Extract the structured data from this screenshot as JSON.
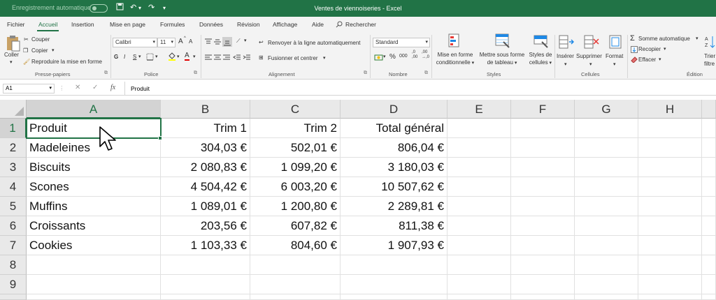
{
  "title_bar": {
    "autosave_label": "Enregistrement automatique",
    "autosave_state": "off",
    "window_title": "Ventes de viennoiseries - Excel"
  },
  "menu": {
    "tabs": [
      "Fichier",
      "Accueil",
      "Insertion",
      "Mise en page",
      "Formules",
      "Données",
      "Révision",
      "Affichage",
      "Aide"
    ],
    "active_tab": "Accueil",
    "search_label": "Rechercher"
  },
  "ribbon": {
    "clipboard": {
      "paste": "Coller",
      "cut": "Couper",
      "copy": "Copier",
      "format_painter": "Reproduire la mise en forme",
      "group": "Presse-papiers"
    },
    "font": {
      "font_name": "Calibri",
      "font_size": "11",
      "bold": "G",
      "italic": "I",
      "underline": "S",
      "grow": "A",
      "shrink": "A",
      "color_a": "A",
      "group": "Police"
    },
    "alignment": {
      "wrap_text": "Renvoyer à la ligne automatiquement",
      "merge_center": "Fusionner et centrer",
      "group": "Alignement"
    },
    "number": {
      "format": "Standard",
      "percent": "%",
      "thousands": "000",
      "inc_decimal": ",0\n,00",
      "group": "Nombre"
    },
    "styles": {
      "conditional": [
        "Mise en forme",
        "conditionnelle"
      ],
      "as_table": [
        "Mettre sous forme",
        "de tableau"
      ],
      "cell_styles": [
        "Styles de",
        "cellules"
      ],
      "group": "Styles"
    },
    "cells": {
      "insert": "Insérer",
      "delete": "Supprimer",
      "format": "Format",
      "group": "Cellules"
    },
    "editing": {
      "autosum": "Somme automatique",
      "fill": "Recopier",
      "clear": "Effacer",
      "sort": [
        "Trier",
        "filtre"
      ],
      "group": "Édition"
    }
  },
  "formula_bar": {
    "name_box": "A1",
    "fx": "fx",
    "content": "Produit"
  },
  "sheet": {
    "columns": [
      "A",
      "B",
      "C",
      "D",
      "E",
      "F",
      "G",
      "H"
    ],
    "rows": [
      "1",
      "2",
      "3",
      "4",
      "5",
      "6",
      "7",
      "8",
      "9"
    ],
    "headers": [
      "Produit",
      "Trim 1",
      "Trim 2",
      "Total général"
    ],
    "data": [
      [
        "Madeleines",
        "304,03 €",
        "502,01 €",
        "806,04 €"
      ],
      [
        "Biscuits",
        "2 080,83 €",
        "1 099,20 €",
        "3 180,03 €"
      ],
      [
        "Scones",
        "4 504,42 €",
        "6 003,20 €",
        "10 507,62 €"
      ],
      [
        "Muffins",
        "1 089,01 €",
        "1 200,80 €",
        "2 289,81 €"
      ],
      [
        "Croissants",
        "203,56 €",
        "607,82 €",
        "811,38 €"
      ],
      [
        "Cookies",
        "1 103,33 €",
        "804,60 €",
        "1 907,93 €"
      ]
    ]
  }
}
